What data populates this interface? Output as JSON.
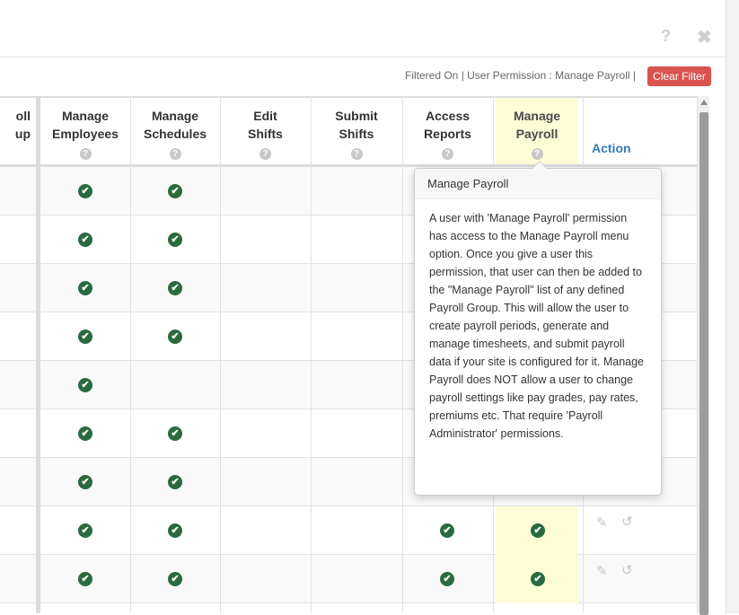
{
  "header": {
    "help_glyph": "?",
    "close_glyph": "✖",
    "filter_text": "Filtered On | User Permission : Manage Payroll |",
    "clear_filter_label": "Clear Filter"
  },
  "columns": [
    {
      "line1": "oll",
      "line2": "up"
    },
    {
      "line1": "Manage",
      "line2": "Employees"
    },
    {
      "line1": "Manage",
      "line2": "Schedules"
    },
    {
      "line1": "Edit",
      "line2": "Shifts"
    },
    {
      "line1": "Submit",
      "line2": "Shifts"
    },
    {
      "line1": "Access",
      "line2": "Reports"
    },
    {
      "line1": "Manage",
      "line2": "Payroll"
    }
  ],
  "column_help_glyph": "?",
  "action_label": "Action",
  "highlight_color": "#fcfdd7",
  "check_color": "#2a6a3e",
  "check_glyph": "✔",
  "pencil_glyph": "✎",
  "history_glyph": "↺",
  "rows": [
    {
      "manage_employees": true,
      "manage_schedules": true,
      "edit_shifts": false,
      "submit_shifts": false,
      "access_reports": null,
      "manage_payroll": null,
      "actions": false
    },
    {
      "manage_employees": true,
      "manage_schedules": true,
      "edit_shifts": false,
      "submit_shifts": false,
      "access_reports": null,
      "manage_payroll": null,
      "actions": false
    },
    {
      "manage_employees": true,
      "manage_schedules": true,
      "edit_shifts": false,
      "submit_shifts": false,
      "access_reports": null,
      "manage_payroll": null,
      "actions": false
    },
    {
      "manage_employees": true,
      "manage_schedules": true,
      "edit_shifts": false,
      "submit_shifts": false,
      "access_reports": null,
      "manage_payroll": null,
      "actions": false
    },
    {
      "manage_employees": true,
      "manage_schedules": false,
      "edit_shifts": false,
      "submit_shifts": false,
      "access_reports": null,
      "manage_payroll": null,
      "actions": false
    },
    {
      "manage_employees": true,
      "manage_schedules": true,
      "edit_shifts": false,
      "submit_shifts": false,
      "access_reports": null,
      "manage_payroll": null,
      "actions": false
    },
    {
      "manage_employees": true,
      "manage_schedules": true,
      "edit_shifts": false,
      "submit_shifts": false,
      "access_reports": null,
      "manage_payroll": null,
      "actions": false
    },
    {
      "manage_employees": true,
      "manage_schedules": true,
      "edit_shifts": false,
      "submit_shifts": false,
      "access_reports": true,
      "manage_payroll": true,
      "actions": true
    },
    {
      "manage_employees": true,
      "manage_schedules": true,
      "edit_shifts": false,
      "submit_shifts": false,
      "access_reports": true,
      "manage_payroll": true,
      "actions": true
    }
  ],
  "tooltip": {
    "title": "Manage Payroll",
    "body": "A user with 'Manage Payroll' permission has access to the Manage Payroll menu option. Once you give a user this permission, that user can then be added to the \"Manage Payroll\" list of any defined Payroll Group. This will allow the user to create payroll periods, generate and manage timesheets, and submit payroll data if your site is configured for it. Manage Payroll does NOT allow a user to change payroll settings like pay grades, pay rates, premiums etc. That require 'Payroll Administrator' permissions."
  }
}
